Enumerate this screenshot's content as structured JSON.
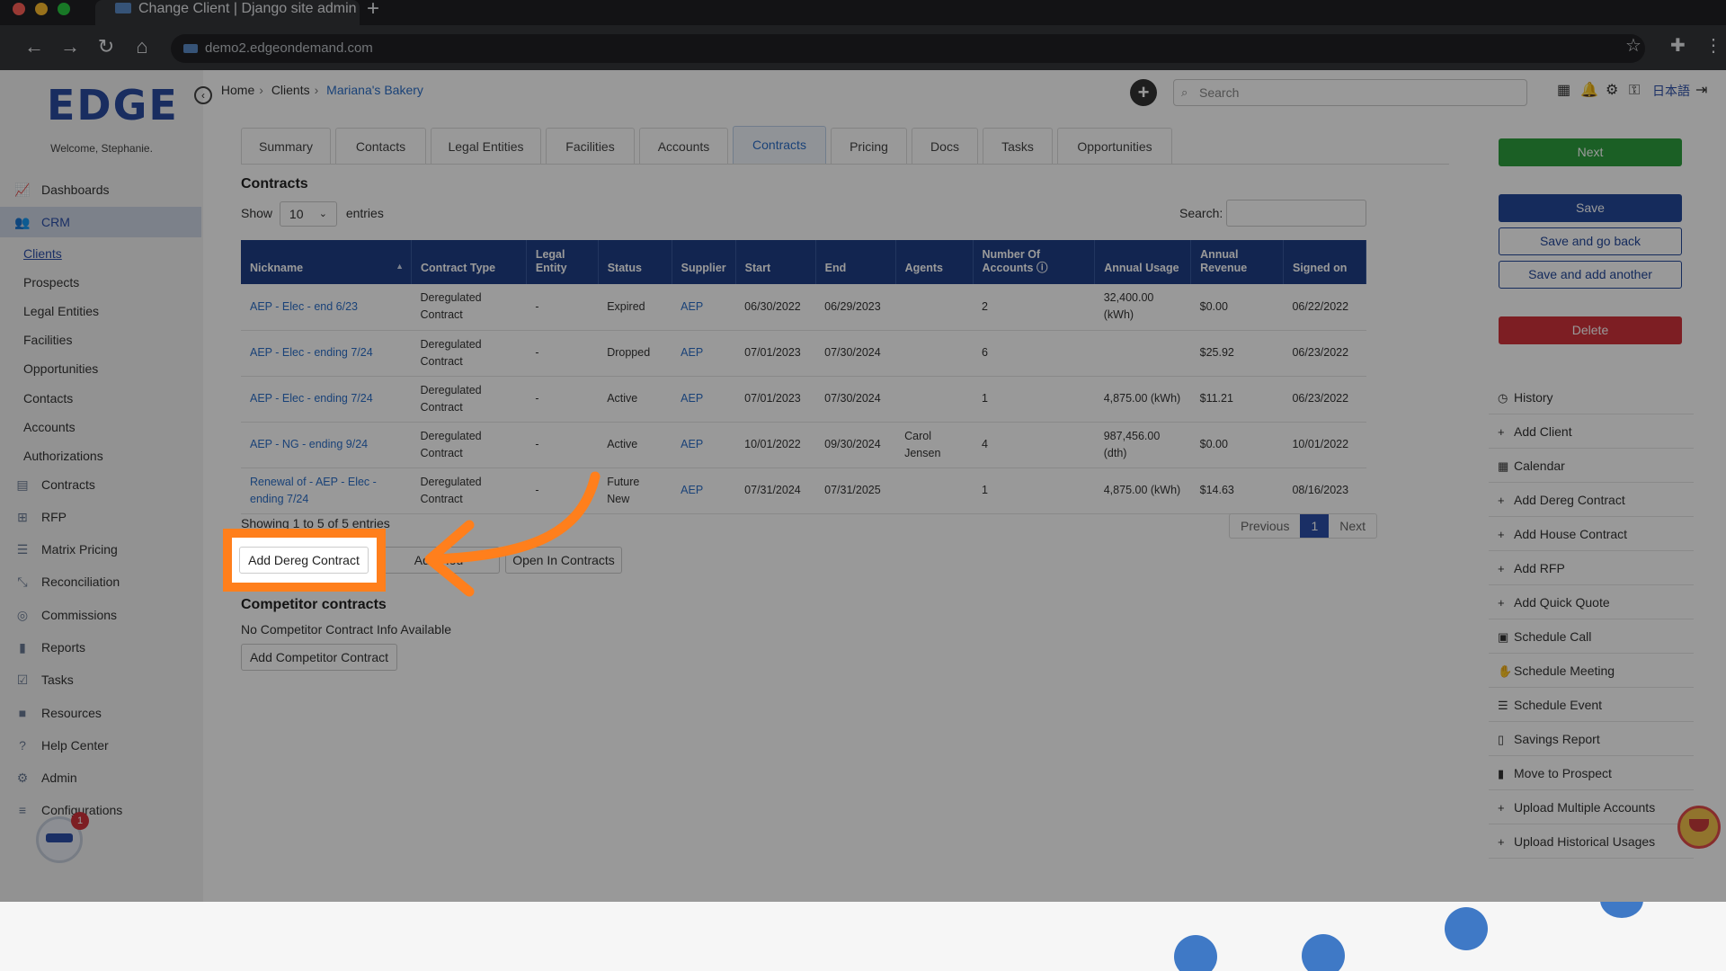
{
  "browser": {
    "tab_title": "Change Client | Django site admin",
    "url": "demo2.edgeondemand.com"
  },
  "sidebar": {
    "logo": "EDGE",
    "welcome": "Welcome, Stephanie.",
    "items": [
      {
        "label": "Dashboards",
        "icon": "chart-line-icon"
      },
      {
        "label": "CRM",
        "icon": "users-icon"
      },
      {
        "label": "Contracts",
        "icon": "file-icon"
      },
      {
        "label": "RFP",
        "icon": "sitemap-icon"
      },
      {
        "label": "Matrix Pricing",
        "icon": "list-icon"
      },
      {
        "label": "Reconciliation",
        "icon": "compress-icon"
      },
      {
        "label": "Commissions",
        "icon": "coins-icon"
      },
      {
        "label": "Reports",
        "icon": "bar-chart-icon"
      },
      {
        "label": "Tasks",
        "icon": "tasks-icon"
      },
      {
        "label": "Resources",
        "icon": "folder-icon"
      },
      {
        "label": "Help Center",
        "icon": "question-icon"
      },
      {
        "label": "Admin",
        "icon": "cogs-icon"
      },
      {
        "label": "Configurations",
        "icon": "sliders-icon"
      }
    ],
    "crm_sub": [
      "Clients",
      "Prospects",
      "Legal Entities",
      "Facilities",
      "Opportunities",
      "Contacts",
      "Accounts",
      "Authorizations"
    ],
    "tour_badge_count": "1"
  },
  "header": {
    "breadcrumb": [
      "Home",
      "Clients",
      "Mariana's Bakery"
    ],
    "search_placeholder": "Search",
    "language": "日本語"
  },
  "tabs": [
    "Summary",
    "Contacts",
    "Legal Entities",
    "Facilities",
    "Accounts",
    "Contracts",
    "Pricing",
    "Docs",
    "Tasks",
    "Opportunities"
  ],
  "contracts": {
    "title": "Contracts",
    "show_label": "Show",
    "page_size": "10",
    "entries_label": "entries",
    "search_label": "Search:",
    "columns": [
      "Nickname",
      "Contract Type",
      "Legal Entity",
      "Status",
      "Supplier",
      "Start",
      "End",
      "Agents",
      "Number Of Accounts",
      "Annual Usage",
      "Annual Revenue",
      "Signed on"
    ],
    "rows": [
      [
        "AEP - Elec - end 6/23",
        "Deregulated Contract",
        "-",
        "Expired",
        "AEP",
        "06/30/2022",
        "06/29/2023",
        "",
        "2",
        "32,400.00 (kWh)",
        "$0.00",
        "06/22/2022"
      ],
      [
        "AEP - Elec - ending 7/24",
        "Deregulated Contract",
        "-",
        "Dropped",
        "AEP",
        "07/01/2023",
        "07/30/2024",
        "",
        "6",
        "",
        "$25.92",
        "06/23/2022"
      ],
      [
        "AEP - Elec - ending 7/24",
        "Deregulated Contract",
        "-",
        "Active",
        "AEP",
        "07/01/2023",
        "07/30/2024",
        "",
        "1",
        "4,875.00 (kWh)",
        "$11.21",
        "06/23/2022"
      ],
      [
        "AEP - NG - ending 9/24",
        "Deregulated Contract",
        "-",
        "Active",
        "AEP",
        "10/01/2022",
        "09/30/2024",
        "Carol Jensen",
        "4",
        "987,456.00 (dth)",
        "$0.00",
        "10/01/2022"
      ],
      [
        "Renewal of - AEP - Elec - ending 7/24",
        "Deregulated Contract",
        "-",
        "Future New",
        "AEP",
        "07/31/2024",
        "07/31/2025",
        "",
        "1",
        "4,875.00 (kWh)",
        "$14.63",
        "08/16/2023"
      ]
    ],
    "info": "Showing 1 to 5 of 5 entries",
    "pager": {
      "previous": "Previous",
      "page": "1",
      "next": "Next"
    },
    "buttons": {
      "add_dereg": "Add Dereg Contract",
      "add_house": "Add Hou",
      "open_in": "Open In Contracts"
    }
  },
  "competitor": {
    "title": "Competitor contracts",
    "empty": "No Competitor Contract Info Available",
    "add_button": "Add Competitor Contract"
  },
  "right_panel": {
    "next": "Next",
    "save": "Save",
    "save_go_back": "Save and go back",
    "save_add_another": "Save and add another",
    "delete": "Delete",
    "actions": [
      {
        "label": "History",
        "icon": "clock-icon"
      },
      {
        "label": "Add Client",
        "icon": "plus-icon"
      },
      {
        "label": "Calendar",
        "icon": "calendar-icon"
      },
      {
        "label": "Add Dereg Contract",
        "icon": "plus-icon"
      },
      {
        "label": "Add House Contract",
        "icon": "plus-icon"
      },
      {
        "label": "Add RFP",
        "icon": "plus-icon"
      },
      {
        "label": "Add Quick Quote",
        "icon": "plus-icon"
      },
      {
        "label": "Schedule Call",
        "icon": "calendar-check-icon"
      },
      {
        "label": "Schedule Meeting",
        "icon": "handshake-icon"
      },
      {
        "label": "Schedule Event",
        "icon": "event-icon"
      },
      {
        "label": "Savings Report",
        "icon": "file-report-icon"
      },
      {
        "label": "Move to Prospect",
        "icon": "contact-icon"
      },
      {
        "label": "Upload Multiple Accounts",
        "icon": "plus-icon"
      },
      {
        "label": "Upload Historical Usages",
        "icon": "plus-icon"
      }
    ]
  },
  "colors": {
    "accent_orange": "#ff7f1c",
    "table_header": "#1f3f86",
    "next_green": "#2e9e3e",
    "delete_red": "#d0333b"
  }
}
